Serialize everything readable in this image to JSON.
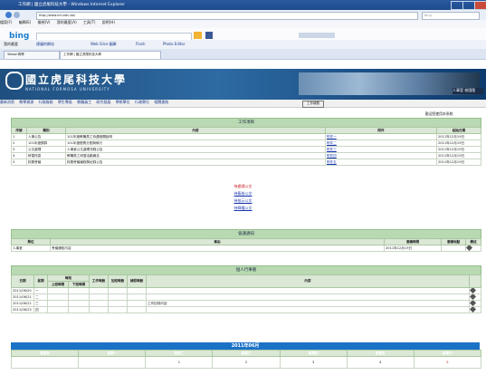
{
  "browser": {
    "window_title": "工作網 | 國立虎尾科技大學 - Windows Internet Explorer",
    "address": "http://www.nfu.edu.tw/",
    "search_placeholder": "Bing",
    "menu": [
      "檔案(F)",
      "編輯(E)",
      "檢視(V)",
      "我的最愛(A)",
      "工具(T)",
      "說明(H)"
    ],
    "bing_label": "bing",
    "favorites_label": "我的最愛",
    "favorites_items": [
      "建議的網站",
      "Web Slice 圖庫",
      "Flash",
      "Photo Editor"
    ],
    "tabs": [
      "Yahoo!奇摩",
      "工作網 | 國立虎尾科技大學"
    ]
  },
  "site": {
    "school_name": "國立虎尾科技大學",
    "school_sub": "NATIONAL FORMOSA UNIVERSITY",
    "lang_select": "人事室 校園版",
    "nav": [
      "最新消息",
      "教學資源",
      "行政服務",
      "學生專區",
      "教職員工",
      "研究發展",
      "學術單位",
      "行政單位",
      "相關連結"
    ],
    "back_button": "工作總覽"
  },
  "user": {
    "welcome": "歡迎您使用本系統"
  },
  "work_items": {
    "title": "工作項目",
    "headers": [
      "序號",
      "類別",
      "內容",
      "附件",
      "起始日期"
    ],
    "rows": [
      [
        "1",
        "人事公告",
        "101年度教職員工待遇相關說明",
        "附件一",
        "2011年12月19日"
      ],
      [
        "2",
        "101年度預算",
        "101年度經費分配與執行",
        "附件二",
        "2011年12月19日"
      ],
      [
        "3",
        "公文處理",
        "人事室公文處理流程公告",
        "附件三",
        "2011年12月19日"
      ],
      [
        "4",
        "研習訊息",
        "教職員工研習活動報名",
        "附件四",
        "2011年12月19日"
      ],
      [
        "5",
        "校務會議",
        "校務會議議程與紀錄公告",
        "附件五",
        "2011年12月19日"
      ]
    ]
  },
  "center_links": [
    {
      "text": "待處理公文",
      "red": true
    },
    {
      "text": "待簽核公文",
      "red": false
    },
    {
      "text": "待批示公文",
      "red": false
    },
    {
      "text": "待歸檔公文",
      "red": false
    }
  ],
  "pending": {
    "title": "會議通知",
    "headers": [
      "單位",
      "事由",
      "會議時間",
      "會議地點",
      "備註"
    ],
    "rows": [
      [
        "人事室",
        "會議通知內容",
        "2011年12月19日",
        "",
        ""
      ]
    ]
  },
  "schedule": {
    "title": "個人行事曆",
    "headers": [
      "日期",
      "星期",
      "時段",
      "工作時數",
      "加班時數",
      "請假時數",
      "內容"
    ],
    "sub_headers": [
      "上班時間",
      "下班時間"
    ],
    "rows": [
      [
        "2011/06/20",
        "一",
        "",
        "",
        "",
        "",
        ""
      ],
      [
        "2011/06/21",
        "二",
        "",
        "",
        "",
        "",
        ""
      ],
      [
        "2011/06/22",
        "三",
        "",
        "",
        "",
        "",
        "工作記錄內容"
      ],
      [
        "2011/06/23",
        "四",
        "",
        "",
        "",
        "",
        ""
      ]
    ]
  },
  "calendar": {
    "title": "2011年06月",
    "days": [
      "星期日",
      "星期一",
      "星期二",
      "星期三",
      "星期四",
      "星期五",
      "星期六"
    ],
    "dates": [
      "",
      "",
      "1",
      "2",
      "3",
      "4",
      "5"
    ]
  },
  "colors": {
    "banner": "#2e6aa3",
    "section_green": "#b9d9b3",
    "calendar_blue": "#1a72c7",
    "link": "#1a37b0",
    "alert_red": "#c4141d"
  }
}
